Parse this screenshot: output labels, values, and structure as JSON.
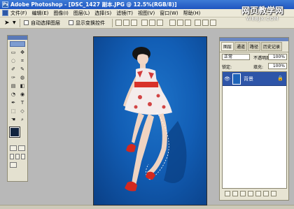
{
  "window": {
    "app_name": "Adobe Photoshop",
    "title": "Adobe Photoshop - [DSC_1427 副本.JPG @ 12.5%(RGB/8)]"
  },
  "watermark": {
    "main": "网页教学网",
    "sub": "WEBJX.COM"
  },
  "menu": {
    "items": [
      "文件(F)",
      "编辑(E)",
      "图像(I)",
      "图层(L)",
      "选择(S)",
      "滤镜(T)",
      "视图(V)",
      "窗口(W)",
      "帮助(H)"
    ]
  },
  "options": {
    "auto_select_layer": "自动选择图层",
    "show_transform": "显示变换控件"
  },
  "toolbox": {
    "tools": [
      "▭",
      "✥",
      "◌",
      "⌗",
      "✐",
      "✎",
      "✑",
      "◍",
      "▤",
      "◧",
      "◔",
      "◉",
      "✒",
      "T",
      "⬚",
      "◇",
      "☚",
      "⌕"
    ],
    "foreground_color": "#10233f",
    "background_color": "#0d1b31"
  },
  "panel": {
    "tabs": [
      "图层",
      "通道",
      "路径",
      "历史记录"
    ],
    "blend_mode": "正常",
    "opacity_label": "不透明度:",
    "opacity": "100%",
    "lock_label": "锁定:",
    "fill_label": "填充:",
    "fill": "100%",
    "layers": [
      {
        "name": "背景",
        "visible": true,
        "locked": true
      }
    ]
  },
  "colors": {
    "canvas_background": "#125eb5",
    "titlebar": "#1f55c0",
    "selected_layer": "#2e55a8"
  }
}
